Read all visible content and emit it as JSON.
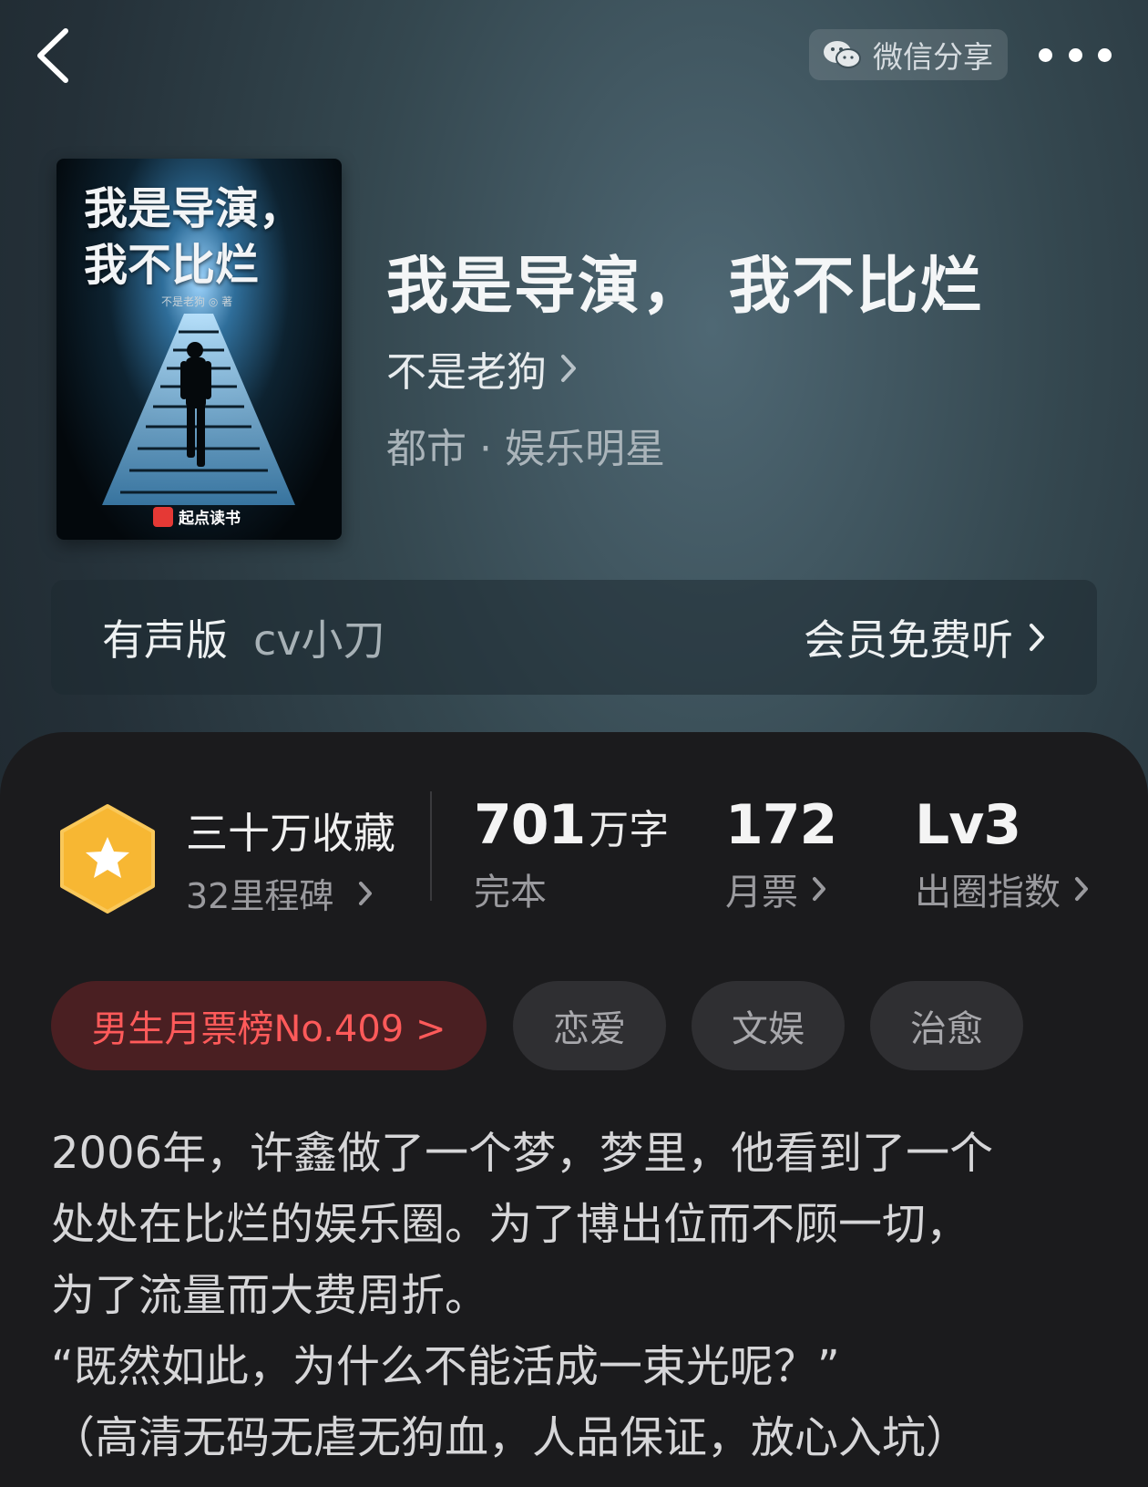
{
  "header": {
    "share_label": "微信分享"
  },
  "book": {
    "cover_title": "我是导演，我不比烂",
    "cover_author": "不是老狗 ◎ 著",
    "cover_brand": "起点读书",
    "title": "我是导演， 我不比烂",
    "author": "不是老狗",
    "genre": "都市 · 娱乐明星"
  },
  "audio": {
    "label": "有声版",
    "cv": "cv小刀",
    "cta": "会员免费听"
  },
  "stats": {
    "collect_main": "三十万收藏",
    "collect_sub": "32里程碑",
    "words_value": "701",
    "words_unit": "万字",
    "words_label": "完本",
    "tickets_value": "172",
    "tickets_label": "月票",
    "index_value": "Lv3",
    "index_label": "出圈指数"
  },
  "tags": {
    "rank": "男生月票榜No.409 >",
    "items": [
      "恋爱",
      "文娱",
      "治愈"
    ]
  },
  "synopsis": {
    "lines": [
      "2006年，许鑫做了一个梦，梦里，他看到了一个",
      "处处在比烂的娱乐圈。为了博出位而不顾一切，",
      "为了流量而大费周折。",
      "“既然如此，为什么不能活成一束光呢？”",
      "（高清无码无虐无狗血，人品保证，放心入坑）"
    ]
  },
  "colors": {
    "rank_text": "#ff5a5a",
    "rank_bg": "#4a1f22",
    "badge": "#f7b733"
  }
}
